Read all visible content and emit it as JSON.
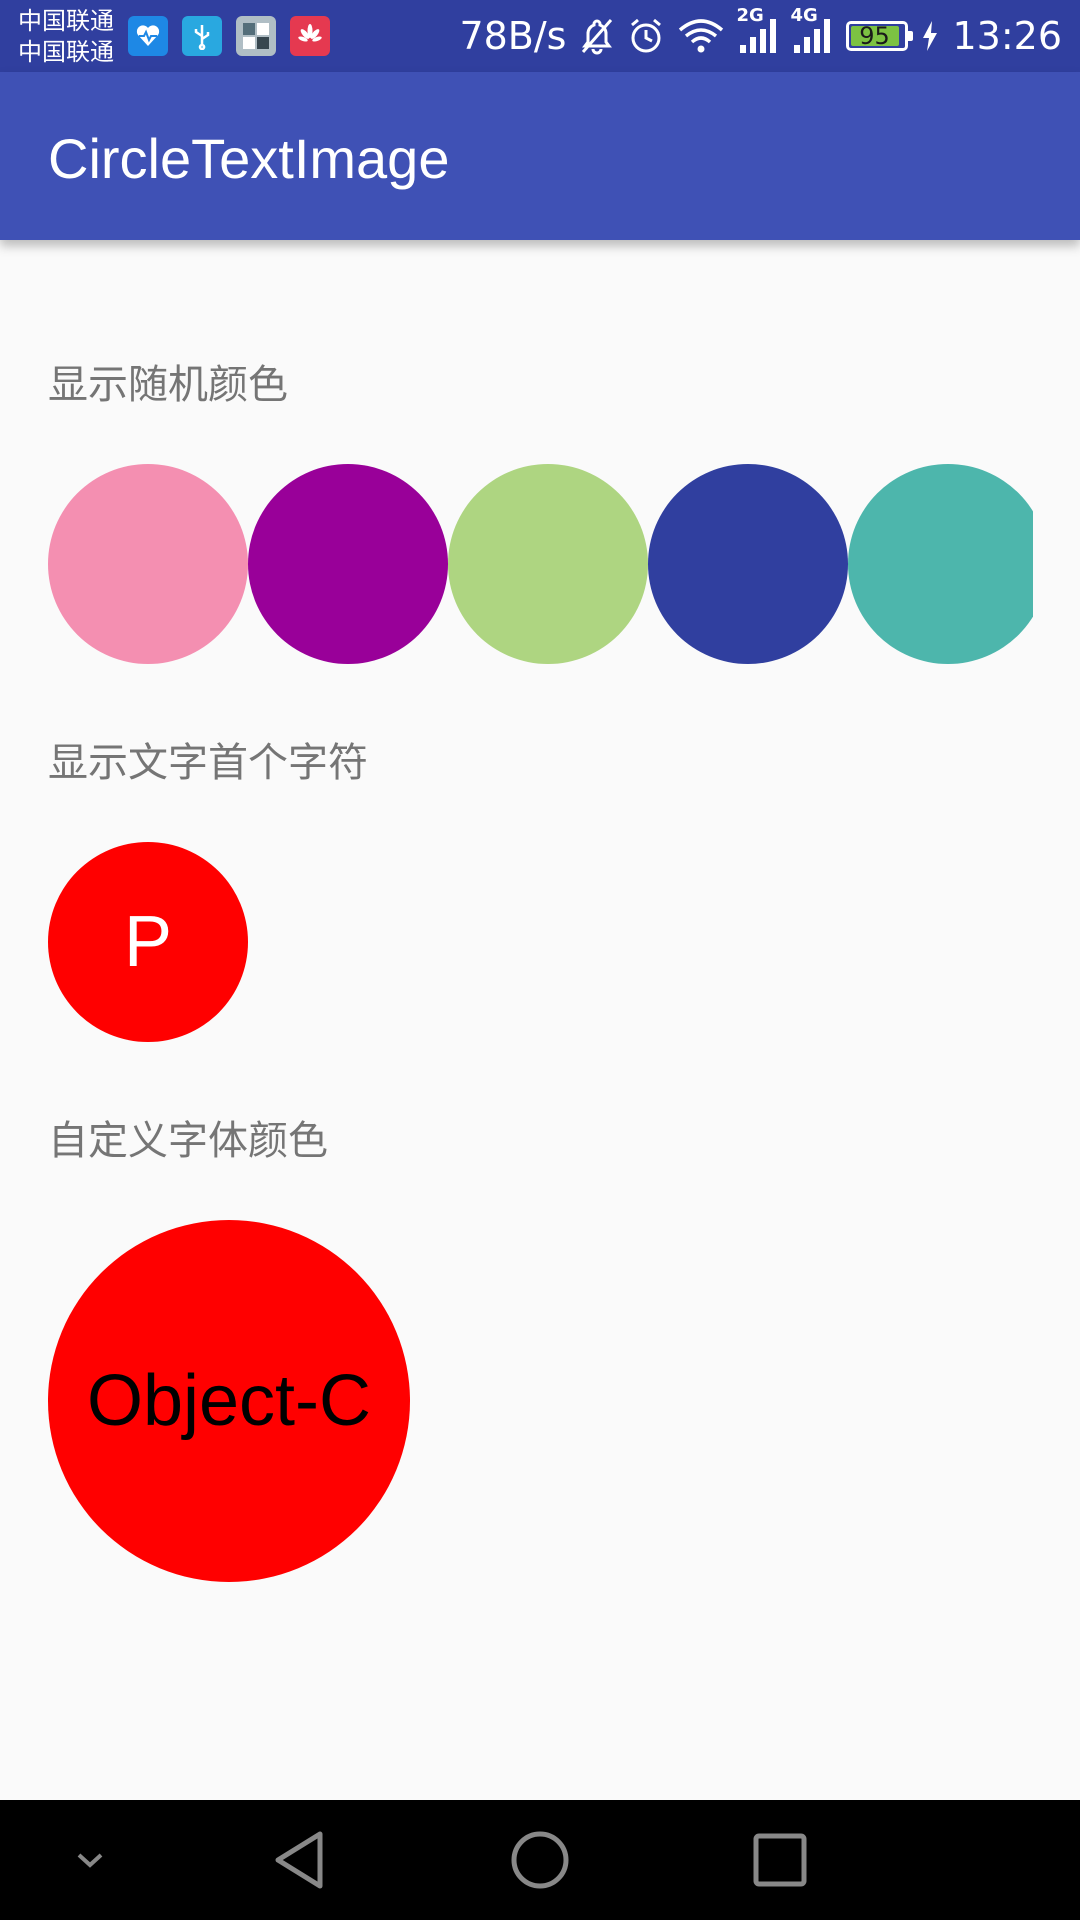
{
  "status_bar": {
    "carrier_1": "中国联通",
    "carrier_2": "中国联通",
    "net_speed": "78B/s",
    "signal_1_type": "2G",
    "signal_2_type": "4G",
    "battery_level": "95",
    "time": "13:26",
    "icons": [
      "health-app-icon",
      "usb-icon",
      "gallery-icon",
      "huawei-icon",
      "mute-icon",
      "alarm-icon",
      "wifi-icon",
      "signal-icon",
      "battery-icon",
      "charging-icon"
    ]
  },
  "app_bar": {
    "title": "CircleTextImage"
  },
  "sections": [
    {
      "label": "显示随机颜色",
      "circle_colors": [
        "#f48fb1",
        "#990099",
        "#aed581",
        "#303f9f",
        "#4db6ac"
      ]
    },
    {
      "label": "显示文字首个字符",
      "circle_text": "P",
      "circle_color": "#ff0000",
      "text_color": "#ffffff"
    },
    {
      "label": "自定义字体颜色",
      "circle_text": "Object-C",
      "circle_color": "#ff0000",
      "text_color": "#000000"
    }
  ],
  "nav_bar": {
    "buttons": [
      "collapse",
      "back",
      "home",
      "recents"
    ]
  }
}
